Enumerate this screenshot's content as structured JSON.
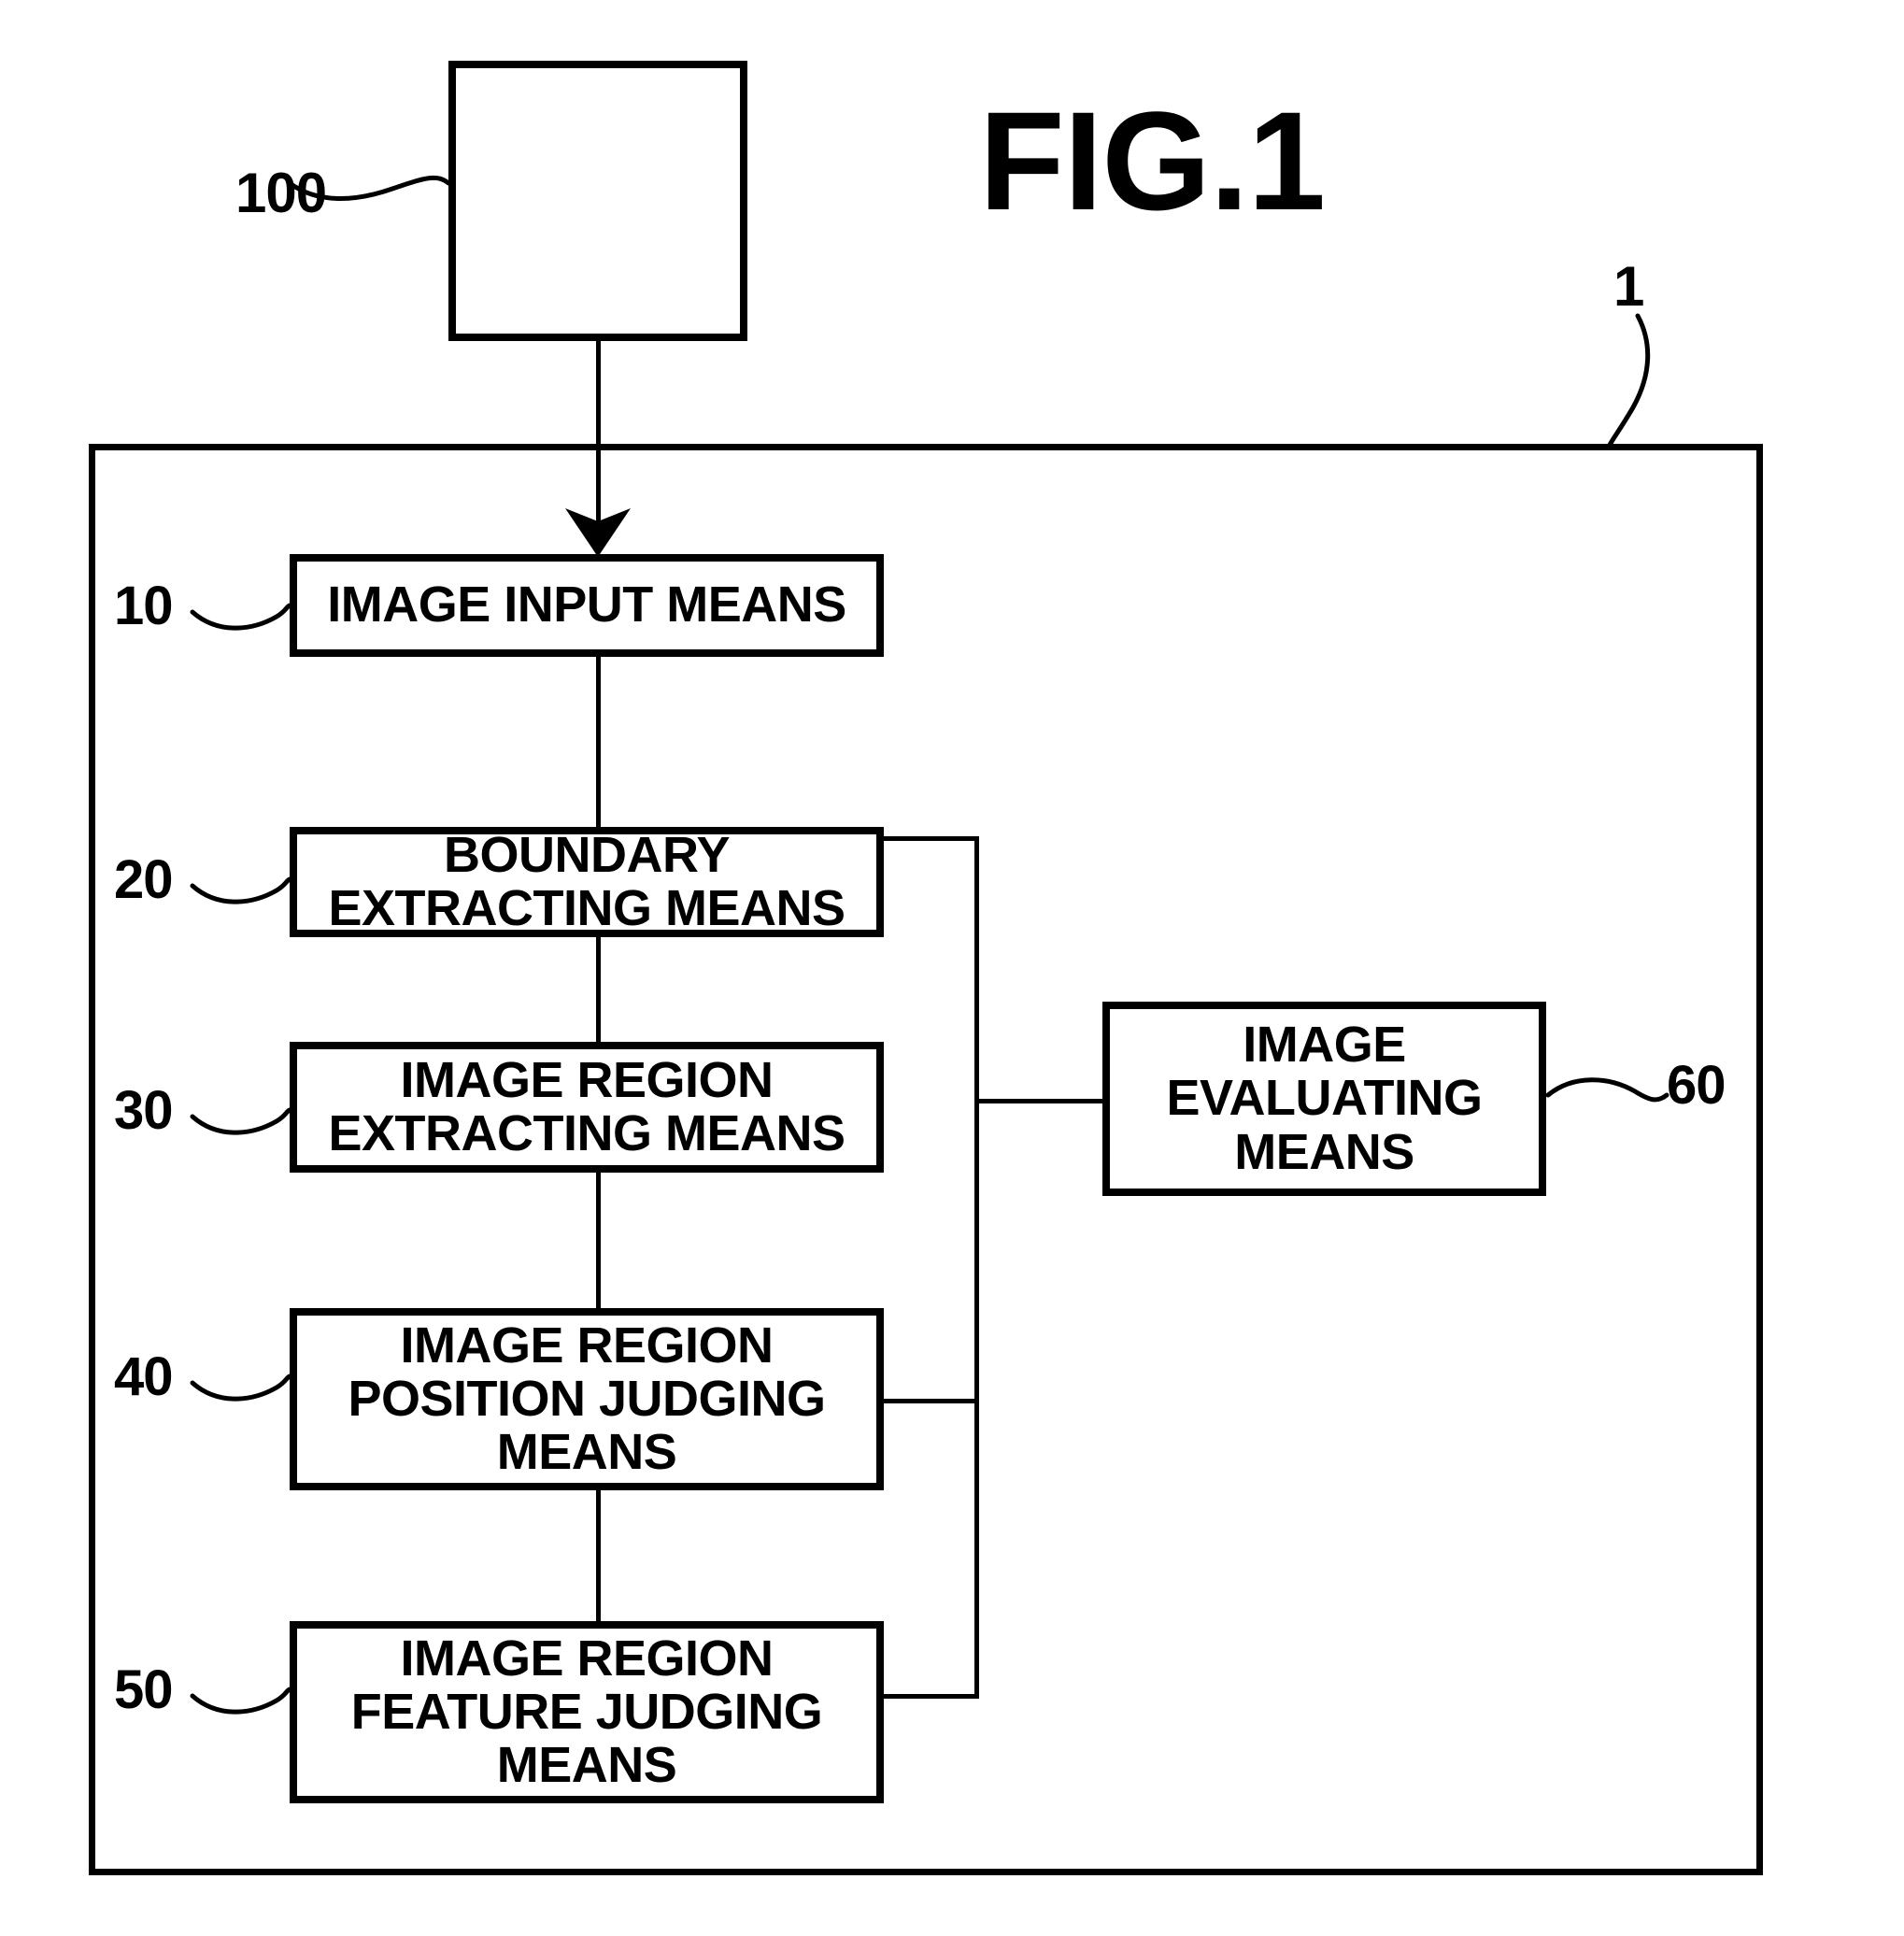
{
  "figure": {
    "title": "FIG.1",
    "system_ref": "1"
  },
  "source": {
    "ref": "100",
    "label": ""
  },
  "blocks": [
    {
      "ref": "10",
      "name": "image-input-means",
      "lines": [
        "IMAGE INPUT MEANS"
      ]
    },
    {
      "ref": "20",
      "name": "boundary-extracting-means",
      "lines": [
        "BOUNDARY",
        "EXTRACTING MEANS"
      ]
    },
    {
      "ref": "30",
      "name": "image-region-extracting-means",
      "lines": [
        "IMAGE REGION",
        "EXTRACTING MEANS"
      ]
    },
    {
      "ref": "40",
      "name": "image-region-position-judging-means",
      "lines": [
        "IMAGE REGION",
        "POSITION JUDGING",
        "MEANS"
      ]
    },
    {
      "ref": "50",
      "name": "image-region-feature-judging-means",
      "lines": [
        "IMAGE REGION",
        "FEATURE JUDGING",
        "MEANS"
      ]
    }
  ],
  "evaluator": {
    "ref": "60",
    "name": "image-evaluating-means",
    "lines": [
      "IMAGE",
      "EVALUATING",
      "MEANS"
    ]
  },
  "colors": {
    "ink": "#000000",
    "paper": "#ffffff"
  }
}
